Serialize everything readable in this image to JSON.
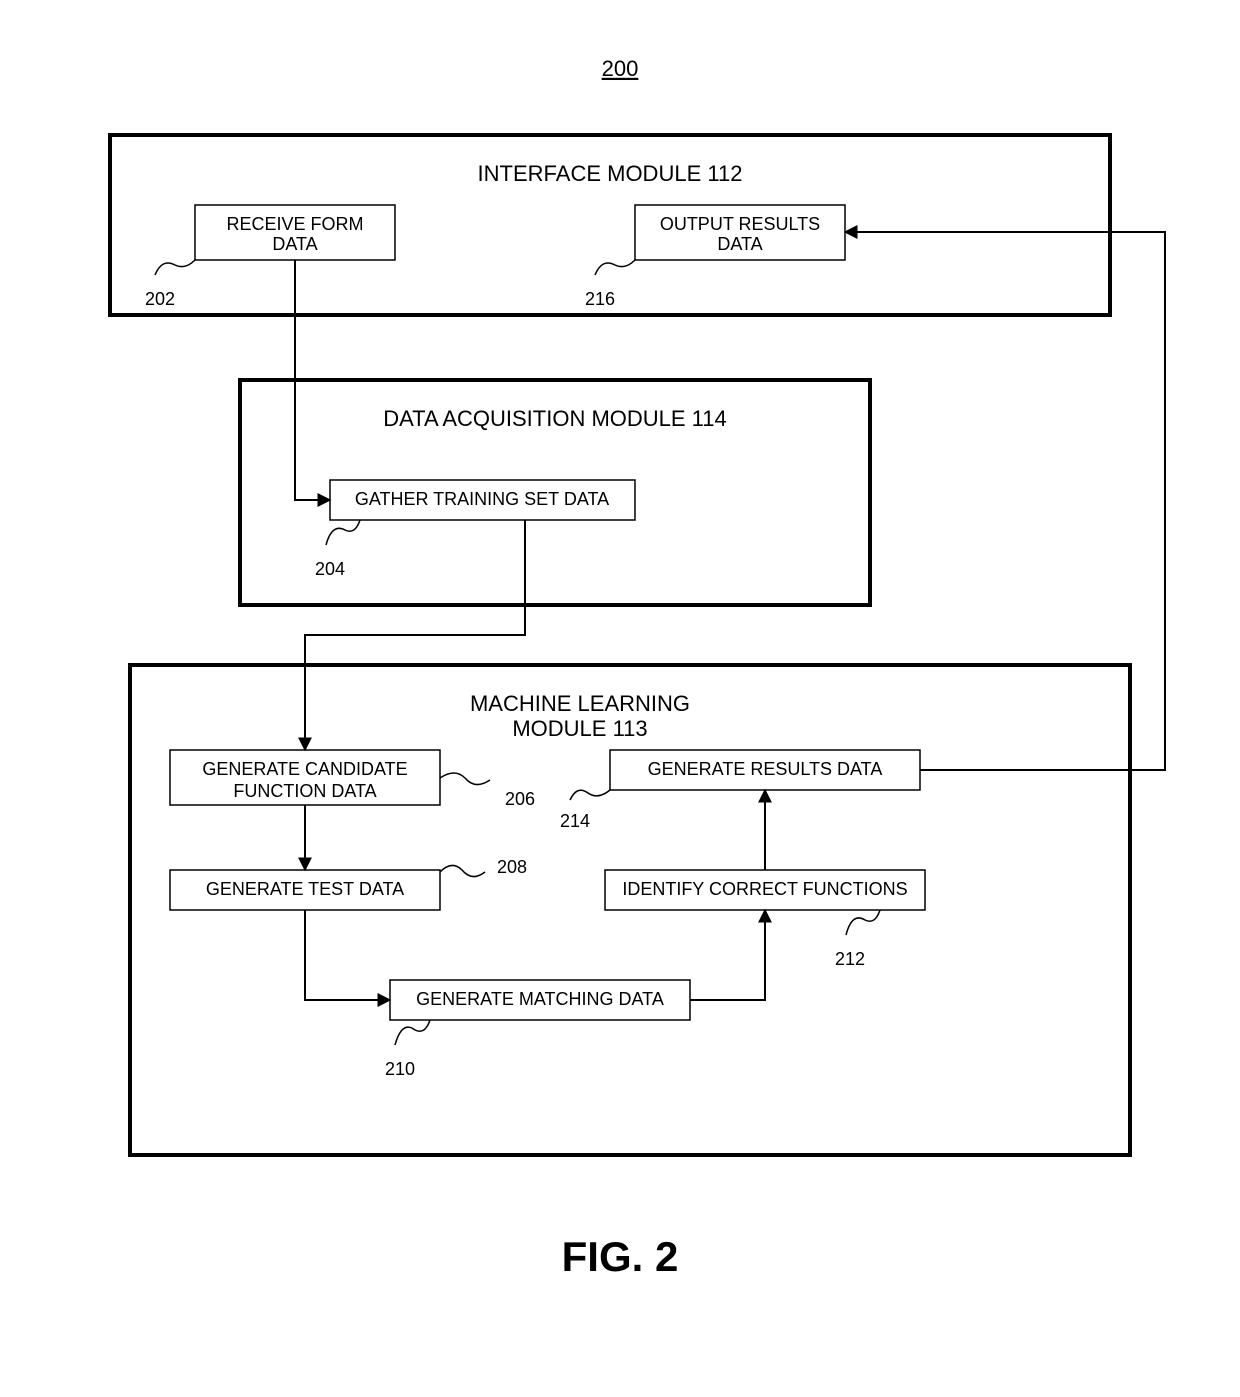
{
  "figure": {
    "page_ref": "200",
    "caption": "FIG. 2"
  },
  "modules": {
    "interface": {
      "title": "INTERFACE MODULE 112",
      "receive_form": {
        "line1": "RECEIVE FORM",
        "line2": "DATA",
        "ref": "202"
      },
      "output_results": {
        "line1": "OUTPUT RESULTS",
        "line2": "DATA",
        "ref": "216"
      }
    },
    "data_acq": {
      "title": "DATA ACQUISITION MODULE 114",
      "gather": {
        "label": "GATHER TRAINING SET DATA",
        "ref": "204"
      }
    },
    "ml": {
      "title1": "MACHINE LEARNING",
      "title2": "MODULE 113",
      "gen_candidate": {
        "line1": "GENERATE CANDIDATE",
        "line2": "FUNCTION DATA",
        "ref": "206"
      },
      "gen_test": {
        "label": "GENERATE TEST DATA",
        "ref": "208"
      },
      "gen_match": {
        "label": "GENERATE MATCHING DATA",
        "ref": "210"
      },
      "identify": {
        "label": "IDENTIFY CORRECT FUNCTIONS",
        "ref": "212"
      },
      "gen_results": {
        "label": "GENERATE RESULTS DATA",
        "ref": "214"
      }
    }
  }
}
